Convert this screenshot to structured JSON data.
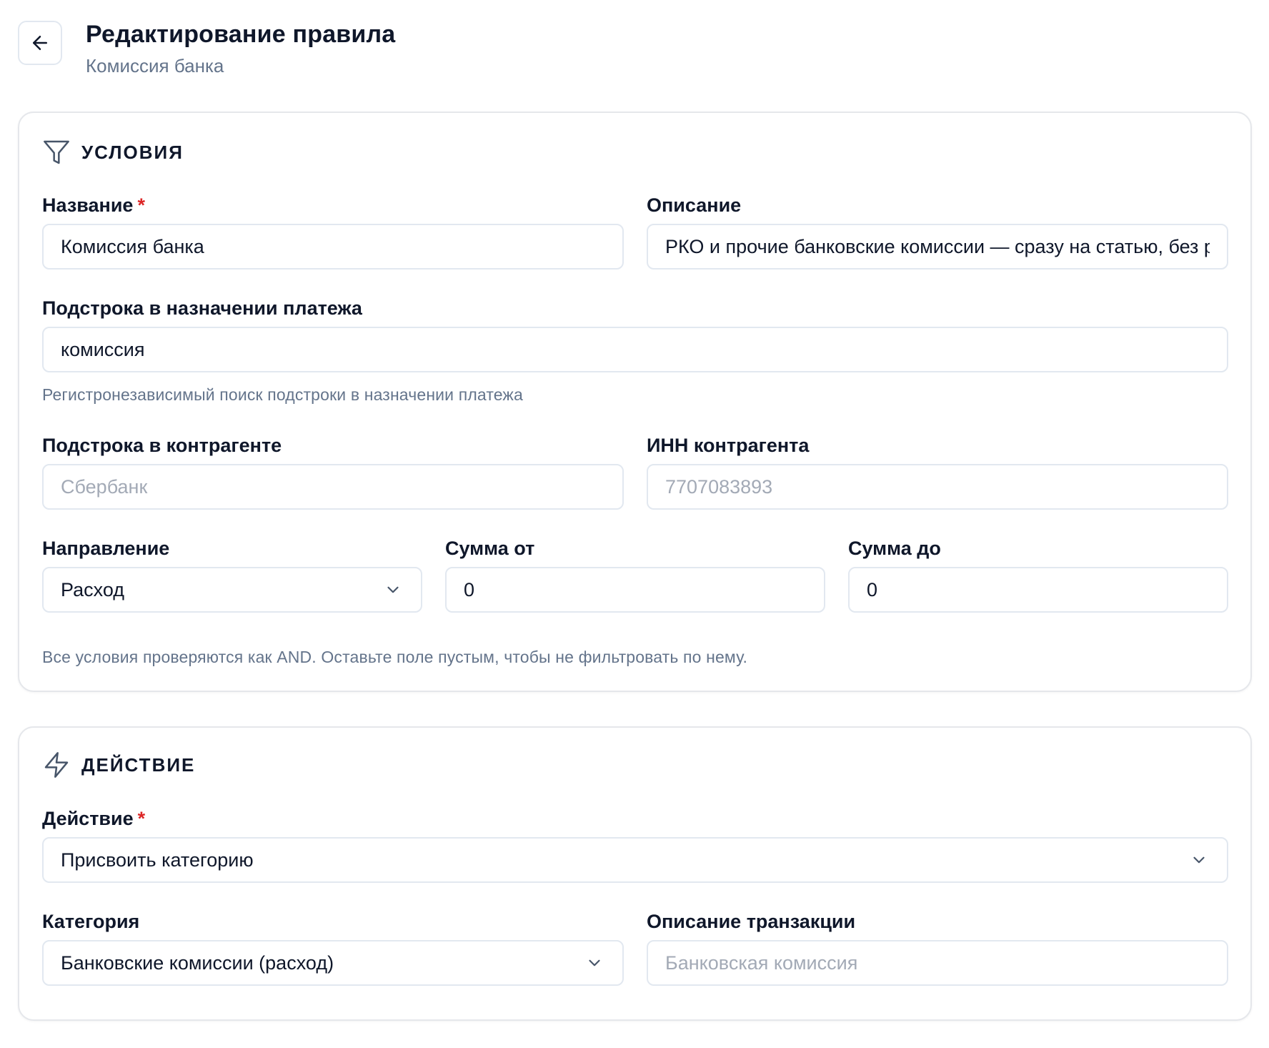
{
  "header": {
    "back_icon": "arrow-left-icon",
    "title": "Редактирование правила",
    "subtitle": "Комиссия банка"
  },
  "conditions": {
    "icon": "filter-icon",
    "title": "УСЛОВИЯ",
    "name": {
      "label": "Название",
      "required_mark": "*",
      "value": "Комиссия банка"
    },
    "description": {
      "label": "Описание",
      "value": "РКО и прочие банковские комиссии — сразу на статью, без разметки вручную"
    },
    "purpose_substring": {
      "label": "Подстрока в назначении платежа",
      "value": "комиссия",
      "hint": "Регистронезависимый поиск подстроки в назначении платежа"
    },
    "counterparty_substring": {
      "label": "Подстрока в контрагенте",
      "placeholder": "Сбербанк"
    },
    "counterparty_inn": {
      "label": "ИНН контрагента",
      "placeholder": "7707083893"
    },
    "direction": {
      "label": "Направление",
      "value": "Расход"
    },
    "amount_from": {
      "label": "Сумма от",
      "value": "0"
    },
    "amount_to": {
      "label": "Сумма до",
      "value": "0"
    },
    "footer_hint": "Все условия проверяются как AND. Оставьте поле пустым, чтобы не фильтровать по нему."
  },
  "action": {
    "icon": "zap-icon",
    "title": "ДЕЙСТВИЕ",
    "action_select": {
      "label": "Действие",
      "required_mark": "*",
      "value": "Присвоить категорию"
    },
    "category": {
      "label": "Категория",
      "value": "Банковские комиссии (расход)"
    },
    "transaction_description": {
      "label": "Описание транзакции",
      "placeholder": "Банковская комиссия"
    }
  }
}
